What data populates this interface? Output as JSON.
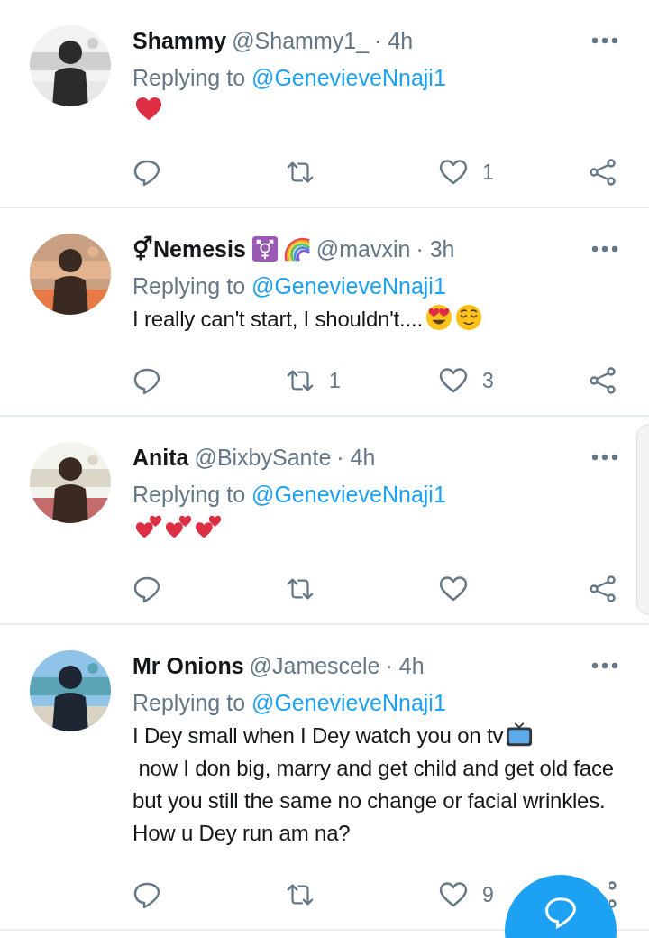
{
  "tweets": [
    {
      "avatar": {
        "kind": "picture"
      },
      "name": "Shammy",
      "handle": "@Shammy1_",
      "time": "· 4h",
      "replying_label": "Replying to",
      "replying_to": "@GenevieveNnaji1",
      "body": [
        {
          "kind": "heart"
        }
      ],
      "likes": "1"
    },
    {
      "avatar": {
        "kind": "picture"
      },
      "name": "⚥Nemesis",
      "name_emojis": [
        {
          "kind": "transgender"
        },
        {
          "kind": "rainbow"
        }
      ],
      "handle": "@mavxin",
      "time": "· 3h",
      "replying_label": "Replying to",
      "replying_to": "@GenevieveNnaji1",
      "body": [
        {
          "kind": "text",
          "text": "I really can't start, I shouldn't...."
        },
        {
          "kind": "heart-eyes"
        },
        {
          "kind": "relieved"
        }
      ],
      "retweets": "1",
      "likes": "3"
    },
    {
      "avatar": {
        "kind": "picture"
      },
      "name": "Anita",
      "handle": "@BixbySante",
      "time": "· 4h",
      "replying_label": "Replying to",
      "replying_to": "@GenevieveNnaji1",
      "body": [
        {
          "kind": "two-hearts"
        },
        {
          "kind": "two-hearts"
        },
        {
          "kind": "two-hearts"
        }
      ]
    },
    {
      "avatar": {
        "kind": "picture"
      },
      "name": "Mr Onions",
      "handle": "@Jamescele",
      "time": "· 4h",
      "replying_label": "Replying to",
      "replying_to": "@GenevieveNnaji1",
      "body": [
        {
          "kind": "text",
          "text": "I Dey small when I Dey watch you on tv"
        },
        {
          "kind": "tv"
        },
        {
          "kind": "text",
          "text": " now I don big, marry and get child and get old face but you still the same no change or facial wrinkles. How u Dey run am na?"
        }
      ],
      "likes": "9"
    }
  ]
}
